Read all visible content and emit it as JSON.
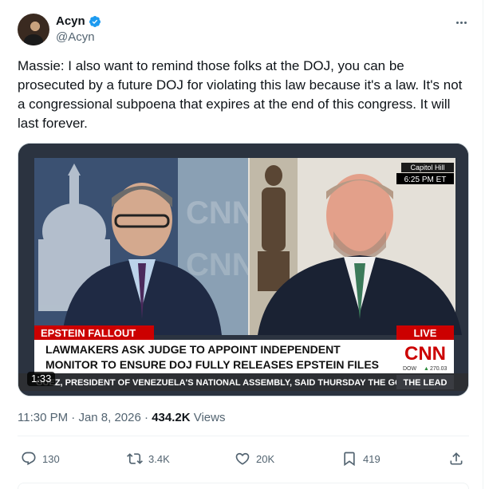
{
  "author": {
    "display_name": "Acyn",
    "handle": "@Acyn",
    "verified": true,
    "avatar_icon": "avatar-photo"
  },
  "tweet": {
    "text": "Massie: I also want to remind those folks at the DOJ, you can be prosecuted by a future DOJ for violating this law because it's a law. It's not a congressional subpoena that expires at the end of this congress. It will last forever."
  },
  "media": {
    "duration": "1:33",
    "location_tag": "Capitol Hill",
    "time_tag": "6:25 PM ET",
    "network_logo": "CNN",
    "topic_banner": "EPSTEIN FALLOUT",
    "live_label": "LIVE",
    "headline_line1": "LAWMAKERS ASK JUDGE TO APPOINT INDEPENDENT",
    "headline_line2": "MONITOR TO ENSURE DOJ FULLY RELEASES EPSTEIN FILES",
    "dow_label": "DOW",
    "dow_value": "270.03",
    "ticker_text": "GUEZ, PRESIDENT OF VENEZUELA'S NATIONAL ASSEMBLY, SAID THURSDAY THE GOV",
    "show_name": "THE LEAD"
  },
  "meta": {
    "time": "11:30 PM",
    "separator": "·",
    "date": "Jan 8, 2026",
    "views_count": "434.2K",
    "views_label": "Views"
  },
  "actions": {
    "replies": "130",
    "reposts": "3.4K",
    "likes": "20K",
    "bookmarks": "419"
  },
  "colors": {
    "accent": "#1d9bf0",
    "text_secondary": "#536471",
    "cnn_red": "#cc0000"
  }
}
